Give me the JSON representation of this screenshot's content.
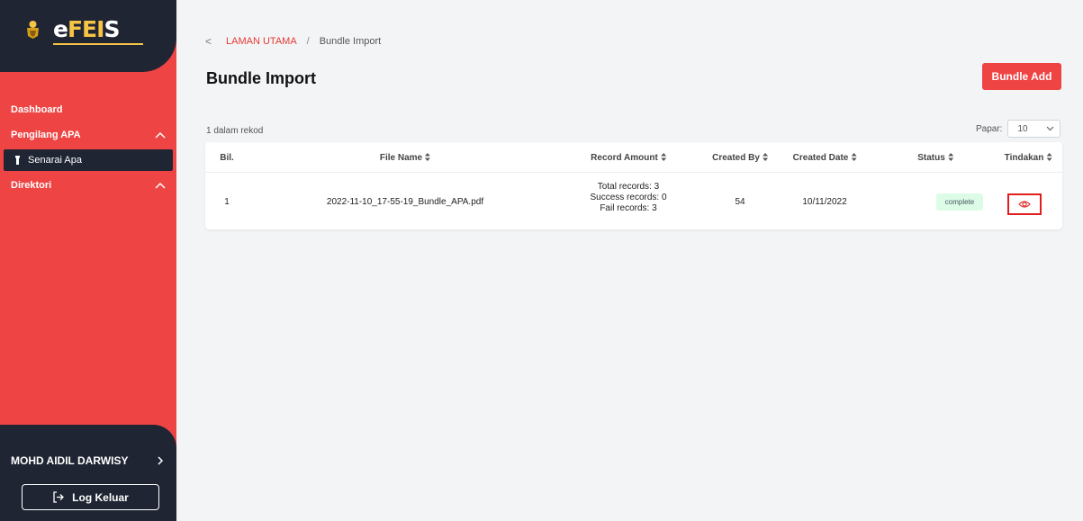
{
  "app": {
    "logo_text_e": "e",
    "logo_text_fei": "FEI",
    "logo_text_s": "S"
  },
  "sidebar": {
    "dashboard": "Dashboard",
    "pengilang": "Pengilang APA",
    "senarai": "Senarai Apa",
    "direktori": "Direktori",
    "user": "MOHD AIDIL DARWISY",
    "logout": "Log Keluar"
  },
  "breadcrumb": {
    "back": "<",
    "home": "LAMAN UTAMA",
    "sep": "/",
    "current": "Bundle Import"
  },
  "page": {
    "title": "Bundle Import",
    "add_button": "Bundle Add",
    "record_count": "1 dalam rekod"
  },
  "papar": {
    "label": "Papar:",
    "value": "10"
  },
  "table": {
    "headers": {
      "bil": "Bil.",
      "file_name": "File Name",
      "record_amount": "Record Amount",
      "created_by": "Created By",
      "created_date": "Created Date",
      "status": "Status",
      "tindakan": "Tindakan"
    },
    "rows": [
      {
        "bil": "1",
        "file_name": "2022-11-10_17-55-19_Bundle_APA.pdf",
        "total": "Total records: 3",
        "success": "Success records: 0",
        "fail": "Fail records: 3",
        "created_by": "54",
        "created_date": "10/11/2022",
        "status": "complete"
      }
    ]
  },
  "icons": {
    "back": "chevron-left-icon",
    "view": "eye-icon",
    "logout": "logout-icon",
    "sort": "sort-icon",
    "select": "chevron-down-icon",
    "user": "chevron-right-icon"
  },
  "colors": {
    "accent": "#ef4444",
    "sidebar_dark": "#1f2533",
    "status_bg": "#dcfce7"
  }
}
